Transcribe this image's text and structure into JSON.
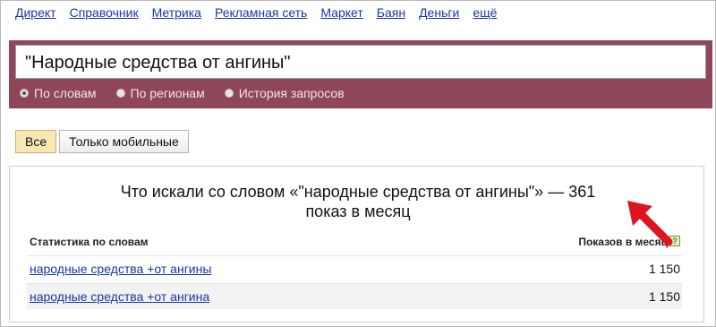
{
  "topnav": [
    "Директ",
    "Справочник",
    "Метрика",
    "Рекламная сеть",
    "Маркет",
    "Баян",
    "Деньги",
    "ещё"
  ],
  "search": {
    "query": "\"Народные средства от ангины\""
  },
  "radios": [
    {
      "label": "По словам",
      "selected": true
    },
    {
      "label": "По регионам",
      "selected": false
    },
    {
      "label": "История запросов",
      "selected": false
    }
  ],
  "filters": {
    "all": "Все",
    "mobile": "Только мобильные"
  },
  "result": {
    "line1": "Что искали со словом «\"народные средства от ангины\"» — 361",
    "line2": "показ в месяц"
  },
  "table": {
    "col_words": "Статистика по словам",
    "col_shows": "Показов в месяц",
    "help": "?",
    "rows": [
      {
        "phrase": "народные средства +от ангины",
        "shows": "1 150"
      },
      {
        "phrase": "народные средства +от ангина",
        "shows": "1 150"
      }
    ]
  },
  "colors": {
    "band": "#8e4658",
    "link": "#1a35a8",
    "arrow": "#e0141e",
    "selected_filter": "#f7e8b3"
  }
}
